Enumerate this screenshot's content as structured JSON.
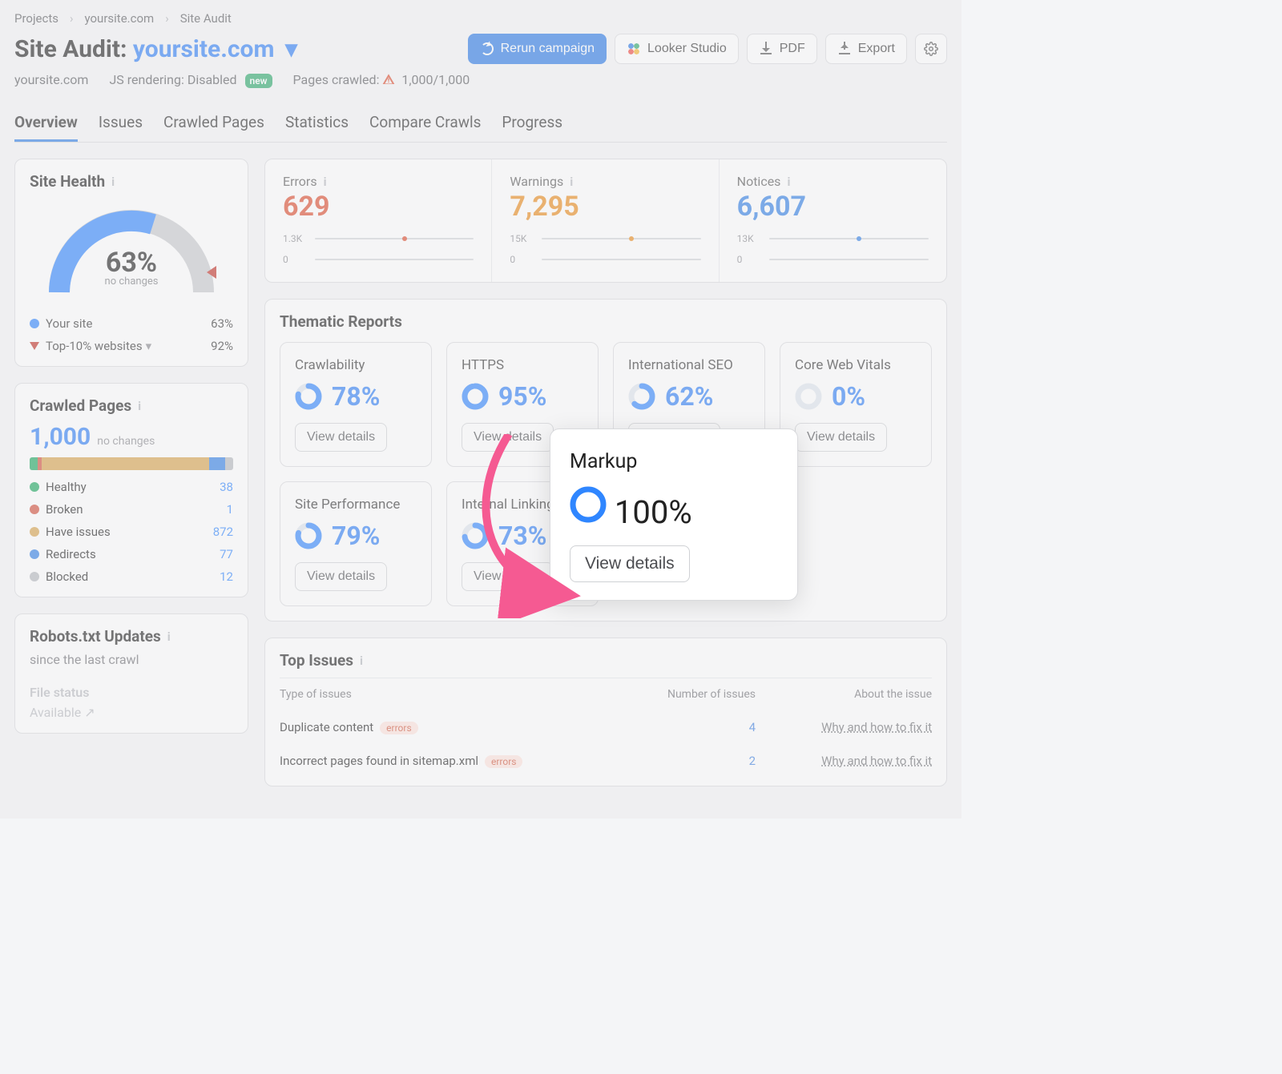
{
  "breadcrumb": {
    "items": [
      "Projects",
      "yoursite.com",
      "Site Audit"
    ]
  },
  "header": {
    "title": "Site Audit:",
    "domain": "yoursite.com",
    "rerun": "Rerun campaign",
    "looker": "Looker Studio",
    "pdf": "PDF",
    "export": "Export"
  },
  "subheader": {
    "domain": "yoursite.com",
    "js_label": "JS rendering: Disabled",
    "badge": "new",
    "crawled_label": "Pages crawled:",
    "crawled_value": "1,000/1,000"
  },
  "tabs": [
    "Overview",
    "Issues",
    "Crawled Pages",
    "Statistics",
    "Compare Crawls",
    "Progress"
  ],
  "site_health": {
    "title": "Site Health",
    "value": "63%",
    "no_changes": "no changes",
    "legend": {
      "your_site": "Your site",
      "your_site_value": "63%",
      "top10": "Top-10% websites",
      "top10_value": "92%"
    }
  },
  "stats": {
    "errors": {
      "label": "Errors",
      "value": "629",
      "max": "1.3K",
      "min": "0",
      "dot_color": "#dc4a2b"
    },
    "warnings": {
      "label": "Warnings",
      "value": "7,295",
      "max": "15K",
      "min": "0",
      "dot_color": "#ea8a19"
    },
    "notices": {
      "label": "Notices",
      "value": "6,607",
      "max": "13K",
      "min": "0",
      "dot_color": "#2f7fe6"
    }
  },
  "crawled": {
    "title": "Crawled Pages",
    "total": "1,000",
    "no_changes": "no changes",
    "rows": [
      {
        "label": "Healthy",
        "value": "38",
        "color": "#1aa85e"
      },
      {
        "label": "Broken",
        "value": "1",
        "color": "#d34e3a"
      },
      {
        "label": "Have issues",
        "value": "872",
        "color": "#d8a24a"
      },
      {
        "label": "Redirects",
        "value": "77",
        "color": "#2f7fe6"
      },
      {
        "label": "Blocked",
        "value": "12",
        "color": "#b6b8bd"
      }
    ],
    "segments": [
      {
        "color": "#1aa85e",
        "pct": 4
      },
      {
        "color": "#d34e3a",
        "pct": 2
      },
      {
        "color": "#d8a24a",
        "pct": 82
      },
      {
        "color": "#2f7fe6",
        "pct": 8
      },
      {
        "color": "#b6b8bd",
        "pct": 4
      }
    ]
  },
  "robots": {
    "title": "Robots.txt Updates",
    "since": "since the last crawl",
    "file_status_label": "File status",
    "file_status_value": "Available"
  },
  "thematic": {
    "title": "Thematic Reports",
    "view_details": "View details",
    "cards_row1": [
      {
        "name": "Crawlability",
        "pct": 78,
        "display": "78%"
      },
      {
        "name": "HTTPS",
        "pct": 95,
        "display": "95%"
      },
      {
        "name": "International SEO",
        "pct": 62,
        "display": "62%"
      },
      {
        "name": "Core Web Vitals",
        "pct": 0,
        "display": "0%"
      }
    ],
    "cards_row2": [
      {
        "name": "Site Performance",
        "pct": 79,
        "display": "79%"
      },
      {
        "name": "Internal Linking",
        "pct": 73,
        "display": "73%"
      }
    ]
  },
  "popout": {
    "name": "Markup",
    "pct": 100,
    "display": "100%"
  },
  "top_issues": {
    "title": "Top Issues",
    "cols": {
      "type": "Type of issues",
      "num": "Number of issues",
      "about": "About the issue"
    },
    "rows": [
      {
        "type": "Duplicate content",
        "tag": "errors",
        "num": "4",
        "about": "Why and how to fix it"
      },
      {
        "type": "Incorrect pages found in sitemap.xml",
        "tag": "errors",
        "num": "2",
        "about": "Why and how to fix it"
      }
    ]
  },
  "chart_data": {
    "gauge": {
      "type": "gauge",
      "value_pct": 63,
      "benchmark_pct": 92,
      "range": [
        0,
        100
      ]
    },
    "segmented_bar": {
      "type": "bar",
      "categories": [
        "Healthy",
        "Broken",
        "Have issues",
        "Redirects",
        "Blocked"
      ],
      "values": [
        38,
        1,
        872,
        77,
        12
      ],
      "title": "Crawled Pages"
    },
    "thematic_rings": {
      "type": "bar",
      "categories": [
        "Crawlability",
        "HTTPS",
        "International SEO",
        "Core Web Vitals",
        "Site Performance",
        "Internal Linking",
        "Markup"
      ],
      "values": [
        78,
        95,
        62,
        0,
        79,
        73,
        100
      ],
      "ylim": [
        0,
        100
      ]
    }
  }
}
